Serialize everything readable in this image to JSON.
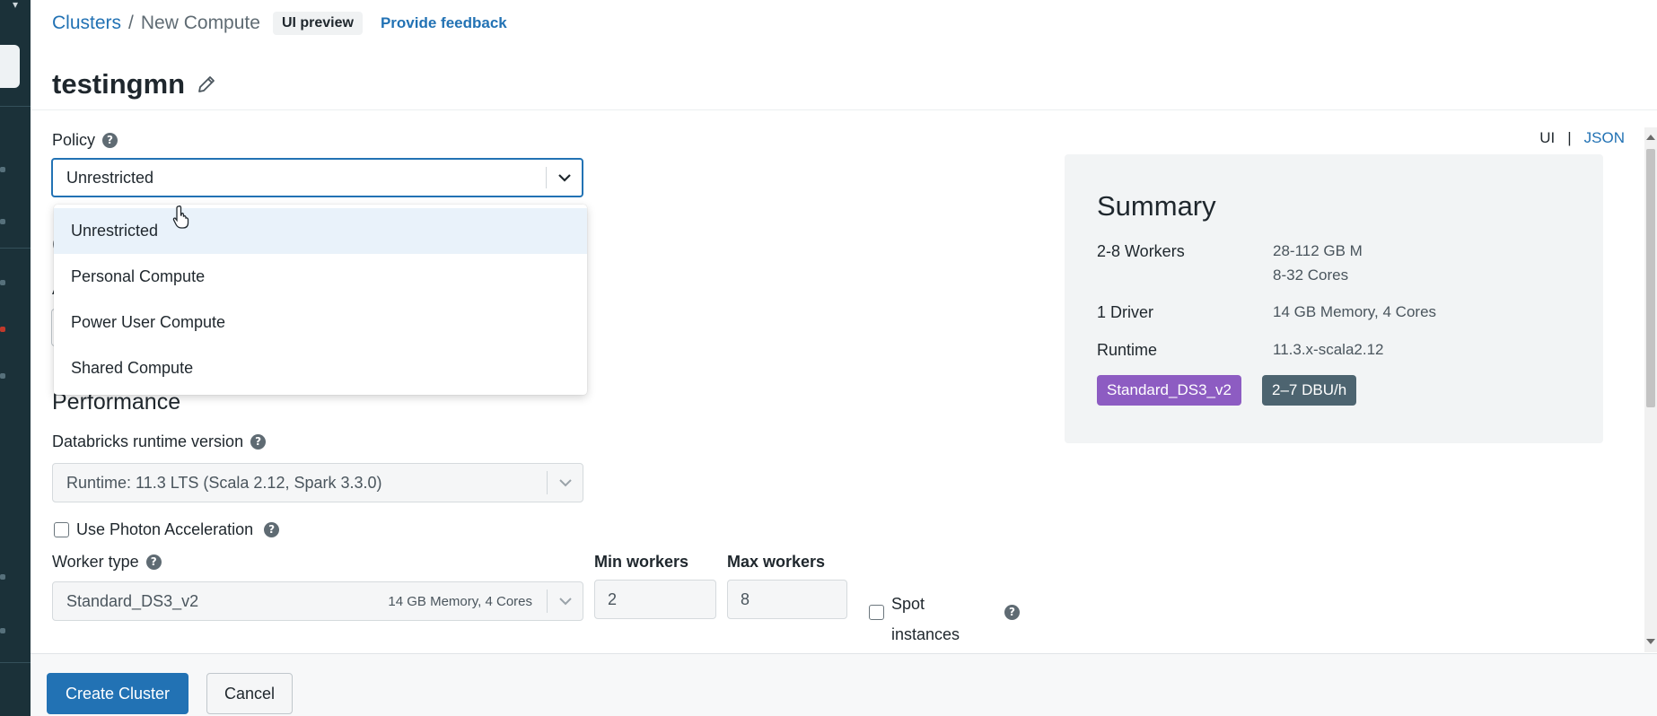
{
  "breadcrumb": {
    "parent": "Clusters",
    "separator": "/",
    "current": "New Compute",
    "badge": "UI preview",
    "feedback": "Provide feedback"
  },
  "page": {
    "title": "testingmn"
  },
  "policy": {
    "label": "Policy",
    "value": "Unrestricted",
    "options": [
      "Unrestricted",
      "Personal Compute",
      "Power User Compute",
      "Shared Compute"
    ],
    "selected_index": 0
  },
  "performance": {
    "title": "Performance",
    "runtime_label": "Databricks runtime version",
    "runtime_value": "Runtime: 11.3 LTS (Scala 2.12, Spark 3.3.0)",
    "photon_label": "Use Photon Acceleration",
    "photon_checked": false,
    "worker_type_label": "Worker type",
    "worker_type_value": "Standard_DS3_v2",
    "worker_type_meta": "14 GB Memory, 4 Cores",
    "min_workers_label": "Min workers",
    "min_workers_value": "2",
    "max_workers_label": "Max workers",
    "max_workers_value": "8",
    "spot_label_line1": "Spot",
    "spot_label_line2": "instances",
    "spot_checked": false
  },
  "view_toggle": {
    "ui": "UI",
    "separator": "|",
    "json": "JSON"
  },
  "summary": {
    "title": "Summary",
    "workers_label": "2-8 Workers",
    "workers_memory": "28-112 GB M",
    "workers_cores": "8-32 Cores",
    "driver_label": "1 Driver",
    "driver_value": "14 GB Memory, 4 Cores",
    "runtime_label": "Runtime",
    "runtime_value": "11.3.x-scala2.12",
    "instance_tag": "Standard_DS3_v2",
    "dbu_tag": "2–7 DBU/h"
  },
  "footer": {
    "create": "Create Cluster",
    "cancel": "Cancel"
  },
  "colors": {
    "accent": "#2272b4",
    "nav": "#1b3139",
    "tag_purple": "#8d5cc2",
    "tag_slate": "#4d6470"
  }
}
